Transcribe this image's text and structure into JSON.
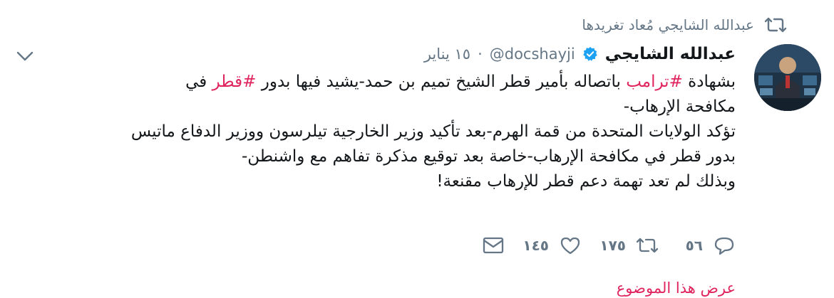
{
  "retweet_context": {
    "text": "عبدالله الشايجي مُعاد تغريدها",
    "icon": "retweet-icon"
  },
  "tweet": {
    "author_name": "عبدالله الشايجي",
    "handle": "@docshayji",
    "separator": "·",
    "date": "١٥ يناير",
    "verified": true,
    "lines": [
      {
        "segments": [
          {
            "t": "بشهادة ",
            "tag": false
          },
          {
            "t": "#ترامب",
            "tag": true
          },
          {
            "t": " باتصاله بأمير قطر الشيخ تميم بن حمد-يشيد فيها بدور ",
            "tag": false
          },
          {
            "t": "#قطر",
            "tag": true
          },
          {
            "t": " في",
            "tag": false
          }
        ]
      },
      {
        "segments": [
          {
            "t": "مكافحة الإرهاب-",
            "tag": false
          }
        ]
      },
      {
        "segments": [
          {
            "t": "تؤكد الولايات المتحدة من قمة الهرم-بعد تأكيد وزير الخارجية تيلرسون ووزير الدفاع ماتيس",
            "tag": false
          }
        ]
      },
      {
        "segments": [
          {
            "t": "بدور قطر في مكافحة الإرهاب-خاصة بعد توقيع مذكرة تفاهم مع واشنطن-",
            "tag": false
          }
        ]
      },
      {
        "segments": [
          {
            "t": "وبذلك لم تعد تهمة دعم قطر للإرهاب مقنعة!",
            "tag": false
          }
        ]
      }
    ]
  },
  "actions": {
    "reply_count": "٥٦",
    "retweet_count": "١٧٥",
    "like_count": "١٤٥"
  },
  "show_thread": "عرض هذا الموضوع",
  "colors": {
    "hashtag": "#e0245e",
    "muted": "#657786",
    "verified": "#1da1f2"
  }
}
